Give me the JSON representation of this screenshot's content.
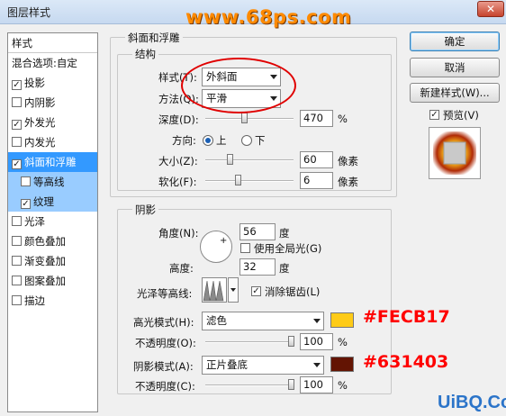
{
  "window": {
    "title": "图层样式",
    "watermark_top": "www.68ps.com",
    "close_label": "✕"
  },
  "left_panel": {
    "header": "样式",
    "items": [
      {
        "label": "混合选项:自定",
        "checkbox": false,
        "checked": false
      },
      {
        "label": "投影",
        "checkbox": true,
        "checked": true
      },
      {
        "label": "内阴影",
        "checkbox": true,
        "checked": false
      },
      {
        "label": "外发光",
        "checkbox": true,
        "checked": true
      },
      {
        "label": "内发光",
        "checkbox": true,
        "checked": false
      },
      {
        "label": "斜面和浮雕",
        "checkbox": true,
        "checked": true
      },
      {
        "label": "等高线",
        "checkbox": true,
        "checked": false
      },
      {
        "label": "纹理",
        "checkbox": true,
        "checked": true
      },
      {
        "label": "光泽",
        "checkbox": true,
        "checked": false
      },
      {
        "label": "颜色叠加",
        "checkbox": true,
        "checked": false
      },
      {
        "label": "渐变叠加",
        "checkbox": true,
        "checked": false
      },
      {
        "label": "图案叠加",
        "checkbox": true,
        "checked": false
      },
      {
        "label": "描边",
        "checkbox": true,
        "checked": false
      }
    ]
  },
  "bevel": {
    "group_title": "斜面和浮雕",
    "structure_title": "结构",
    "style_label": "样式(T):",
    "style_value": "外斜面",
    "technique_label": "方法(Q):",
    "technique_value": "平滑",
    "depth_label": "深度(D):",
    "depth_value": "470",
    "depth_unit": "%",
    "direction_label": "方向:",
    "direction_up": "上",
    "direction_down": "下",
    "direction_selected": "上",
    "size_label": "大小(Z):",
    "size_value": "60",
    "size_unit": "像素",
    "soften_label": "软化(F):",
    "soften_value": "6",
    "soften_unit": "像素"
  },
  "shading": {
    "title": "阴影",
    "angle_label": "角度(N):",
    "angle_value": "56",
    "angle_unit": "度",
    "global_light_label": "使用全局光(G)",
    "global_light_checked": false,
    "altitude_label": "高度:",
    "altitude_value": "32",
    "altitude_unit": "度",
    "gloss_contour_label": "光泽等高线:",
    "anti_alias_label": "消除锯齿(L)",
    "anti_alias_checked": true,
    "highlight_mode_label": "高光模式(H):",
    "highlight_mode_value": "滤色",
    "highlight_color": "#FECB17",
    "highlight_opacity_label": "不透明度(O):",
    "highlight_opacity_value": "100",
    "highlight_opacity_unit": "%",
    "shadow_mode_label": "阴影模式(A):",
    "shadow_mode_value": "正片叠底",
    "shadow_color": "#631403",
    "shadow_opacity_label": "不透明度(C):",
    "shadow_opacity_value": "100",
    "shadow_opacity_unit": "%"
  },
  "annotations": {
    "highlight_hex": "#FECB17",
    "shadow_hex": "#631403"
  },
  "buttons": {
    "ok": "确定",
    "cancel": "取消",
    "new_style": "新建样式(W)...",
    "preview_label": "预览(V)",
    "preview_checked": true
  },
  "watermark_bottom": "UiBQ.CoM"
}
